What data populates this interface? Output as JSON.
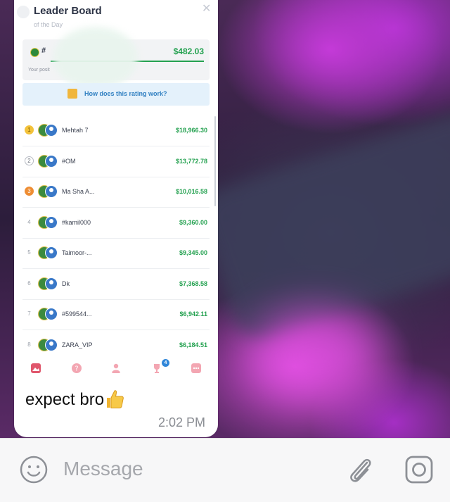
{
  "leaderboard": {
    "title": "Leader Board",
    "subtitle": "of the Day",
    "my_position": {
      "hash": "#",
      "amount": "$482.03",
      "label": "Your posit"
    },
    "how_text": "How does this rating work?",
    "rows": [
      {
        "rank": "1",
        "name": "Mehtah 7",
        "amount": "$18,966.30"
      },
      {
        "rank": "2",
        "name": "#OM",
        "amount": "$13,772.78"
      },
      {
        "rank": "3",
        "name": "Ma Sha A...",
        "amount": "$10,016.58"
      },
      {
        "rank": "4",
        "name": "#kamil000",
        "amount": "$9,360.00"
      },
      {
        "rank": "5",
        "name": "Taimoor-...",
        "amount": "$9,345.00"
      },
      {
        "rank": "6",
        "name": "Dk",
        "amount": "$7,368.58"
      },
      {
        "rank": "7",
        "name": "#599544...",
        "amount": "$6,942.11"
      },
      {
        "rank": "8",
        "name": "ZARA_VIP",
        "amount": "$6,184.51"
      }
    ],
    "tab_badge": "4"
  },
  "message": {
    "caption": "expect bro",
    "time": "2:02 PM"
  },
  "input": {
    "placeholder": "Message"
  },
  "icons": {
    "close": "close-icon",
    "smiley": "smiley-icon",
    "attach": "paperclip-icon",
    "camera": "camera-icon",
    "thumbs_up": "thumbs-up-emoji"
  },
  "colors": {
    "green": "#24a150",
    "link_blue": "#2f7fc1",
    "tab_red": "#e0566c"
  }
}
